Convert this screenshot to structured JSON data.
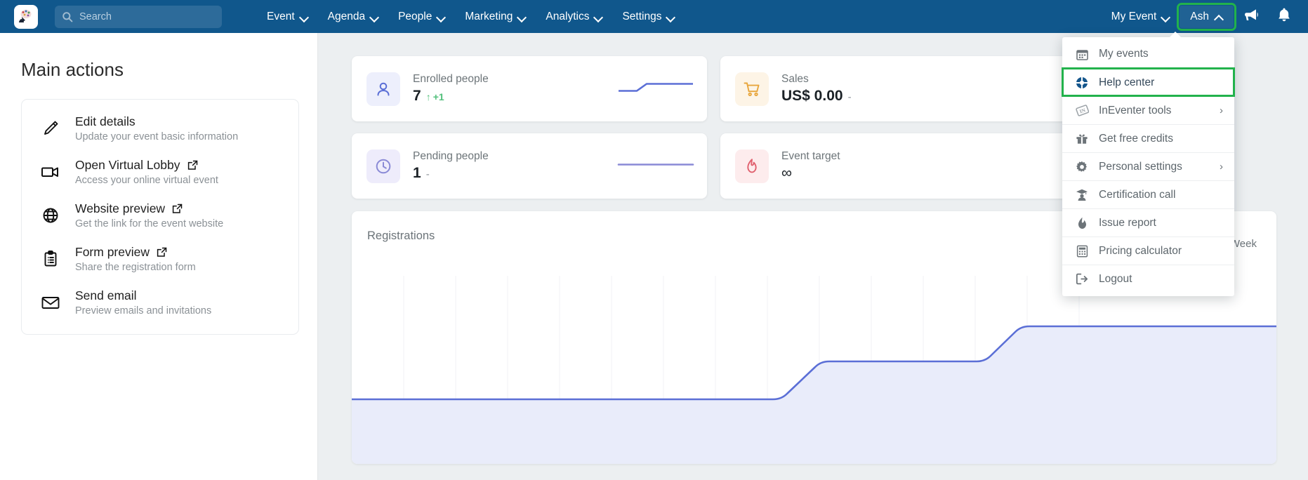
{
  "navbar": {
    "logo_icon": "brain-logo-icon",
    "search": {
      "placeholder": "Search",
      "value": "",
      "icon": "search-icon"
    },
    "links": [
      {
        "label": "Event",
        "caret": "chevron-down-icon"
      },
      {
        "label": "Agenda",
        "caret": "chevron-down-icon"
      },
      {
        "label": "People",
        "caret": "chevron-down-icon"
      },
      {
        "label": "Marketing",
        "caret": "chevron-down-icon"
      },
      {
        "label": "Analytics",
        "caret": "chevron-down-icon"
      },
      {
        "label": "Settings",
        "caret": "chevron-down-icon"
      }
    ],
    "event_selector": {
      "label": "My Event",
      "caret": "chevron-down-icon"
    },
    "user_menu": {
      "label": "Ash",
      "caret": "chevron-up-icon",
      "focused": true
    },
    "announcements_icon": "megaphone-icon",
    "notifications_icon": "bell-icon",
    "bg_color": "#10578c",
    "focus_color": "#22b24c"
  },
  "user_dropdown": {
    "items": [
      {
        "label": "My events",
        "icon": "calendar-icon",
        "submenu": false,
        "highlighted": false
      },
      {
        "label": "Help center",
        "icon": "lifebuoy-icon",
        "submenu": false,
        "highlighted": true
      },
      {
        "label": "InEventer tools",
        "icon": "inevent-badge-icon",
        "submenu": true,
        "chevron": "›",
        "highlighted": false
      },
      {
        "label": "Get free credits",
        "icon": "gift-icon",
        "submenu": false,
        "highlighted": false
      },
      {
        "label": "Personal settings",
        "icon": "gear-icon",
        "submenu": true,
        "chevron": "›",
        "highlighted": false
      },
      {
        "label": "Certification call",
        "icon": "graduation-user-icon",
        "submenu": false,
        "highlighted": false
      },
      {
        "label": "Issue report",
        "icon": "flame-drop-icon",
        "submenu": false,
        "highlighted": false
      },
      {
        "label": "Pricing calculator",
        "icon": "calculator-icon",
        "submenu": false,
        "highlighted": false
      },
      {
        "label": "Logout",
        "icon": "logout-icon",
        "submenu": false,
        "highlighted": false
      }
    ]
  },
  "left_panel": {
    "title": "Main actions",
    "actions": [
      {
        "title": "Edit details",
        "subtitle": "Update your event basic information",
        "icon": "pencil-icon",
        "external": false
      },
      {
        "title": "Open Virtual Lobby",
        "subtitle": "Access your online virtual event",
        "icon": "video-camera-icon",
        "external": true
      },
      {
        "title": "Website preview",
        "subtitle": "Get the link for the event website",
        "icon": "globe-icon",
        "external": true
      },
      {
        "title": "Form preview",
        "subtitle": "Share the registration form",
        "icon": "clipboard-list-icon",
        "external": true
      },
      {
        "title": "Send email",
        "subtitle": "Preview emails and invitations",
        "icon": "envelope-icon",
        "external": false
      }
    ]
  },
  "main": {
    "stats": [
      {
        "label": "Enrolled people",
        "value": "7",
        "delta": "+1",
        "delta_arrow": "↑",
        "dash": "",
        "icon": "person-icon",
        "icon_theme": "blue",
        "spark_color": "#5b77d6"
      },
      {
        "label": "Sales",
        "value": "US$ 0.00",
        "delta": "",
        "dash": "-",
        "icon": "shopping-cart-icon",
        "icon_theme": "orange",
        "spark_color": "#e8a63c"
      },
      {
        "label": "Pending people",
        "value": "1",
        "delta": "",
        "dash": "-",
        "icon": "clock-icon",
        "icon_theme": "purple",
        "spark_color": "#8a8ad6"
      },
      {
        "label": "Event target",
        "value": "∞",
        "delta": "",
        "dash": "",
        "icon": "flame-icon",
        "icon_theme": "red",
        "spark_color": "#e0606e"
      }
    ],
    "registrations": {
      "title": "Registrations",
      "week_label": "Week"
    }
  },
  "chart_data": {
    "type": "area",
    "title": "Registrations",
    "xlabel": "",
    "ylabel": "",
    "x": [
      0,
      1,
      2,
      3,
      4,
      5,
      6,
      7,
      8,
      9,
      10,
      11,
      12,
      13,
      14,
      15,
      16,
      17,
      18
    ],
    "values": [
      0,
      0,
      0,
      0,
      0,
      0,
      0,
      0,
      0,
      0,
      1,
      1,
      1,
      1,
      1,
      1,
      2,
      2,
      2
    ],
    "series": [
      {
        "name": "Registrations",
        "values": [
          0,
          0,
          0,
          0,
          0,
          0,
          0,
          0,
          0,
          0,
          1,
          1,
          1,
          1,
          1,
          1,
          2,
          2,
          2
        ],
        "color": "#5b6fd6",
        "fill": "#e8ebfa"
      }
    ],
    "ylim": [
      0,
      7
    ],
    "grid": true,
    "legend": false
  }
}
